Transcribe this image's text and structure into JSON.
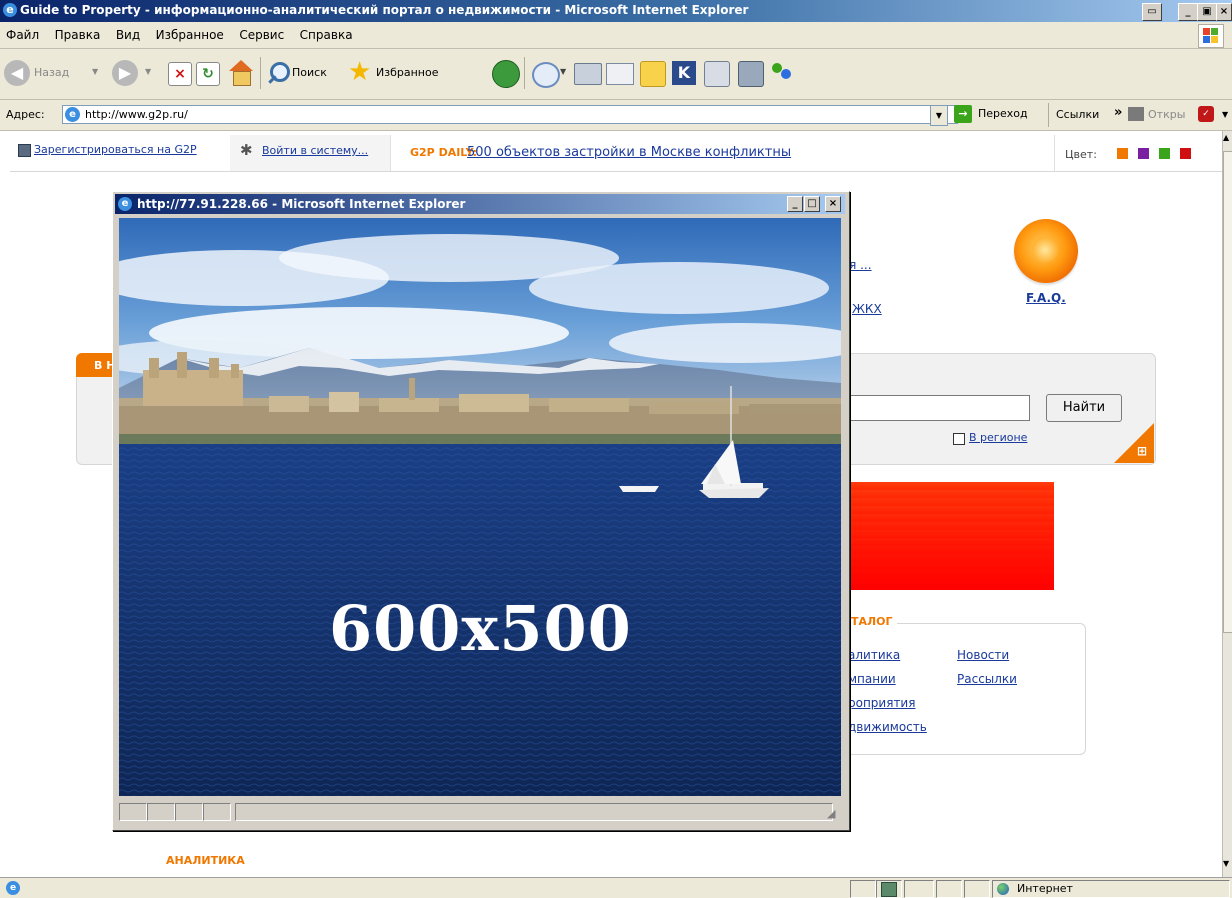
{
  "window": {
    "title": "Guide to Property - информационно-аналитический портал о недвижимости - Microsoft Internet Explorer"
  },
  "menu": [
    "Файл",
    "Правка",
    "Вид",
    "Избранное",
    "Сервис",
    "Справка"
  ],
  "toolbar": {
    "back_label": "Назад",
    "search_label": "Поиск",
    "favorites_label": "Избранное"
  },
  "address": {
    "label": "Адрес:",
    "url": "http://www.g2p.ru/",
    "go_label": "Переход",
    "links_label": "Ссылки",
    "chevron": "»",
    "open_label": "Откры"
  },
  "topbar": {
    "register": "Зарегистрироваться на G2P",
    "login": "Войти в систему...",
    "daily_label": "G2P DAILY:",
    "daily_link": "500 объектов застройки в Москве конфликтны",
    "color_label": "Цвет:",
    "color_swatches": [
      "#f07800",
      "#7a1fa2",
      "#3aa41a",
      "#d01010"
    ]
  },
  "page": {
    "link_partial_1": "ья ...",
    "link_partial_2": "ЖКХ",
    "faq": "F.A.Q.",
    "search_tab_partial": "В Н",
    "search_button": "Найти",
    "region_label": "В регионе",
    "catalog_title_partial": "ТАЛОГ",
    "catalog_col1": [
      "алитика",
      "мпании",
      "роприятия",
      "движимость"
    ],
    "catalog_col2": [
      "Новости",
      "Рассылки"
    ],
    "analytics_heading": "АНАЛИТИКА"
  },
  "popup": {
    "title": "http://77.91.228.66 - Microsoft Internet Explorer",
    "ad_text": "600x500"
  },
  "status": {
    "zone": "Интернет"
  }
}
